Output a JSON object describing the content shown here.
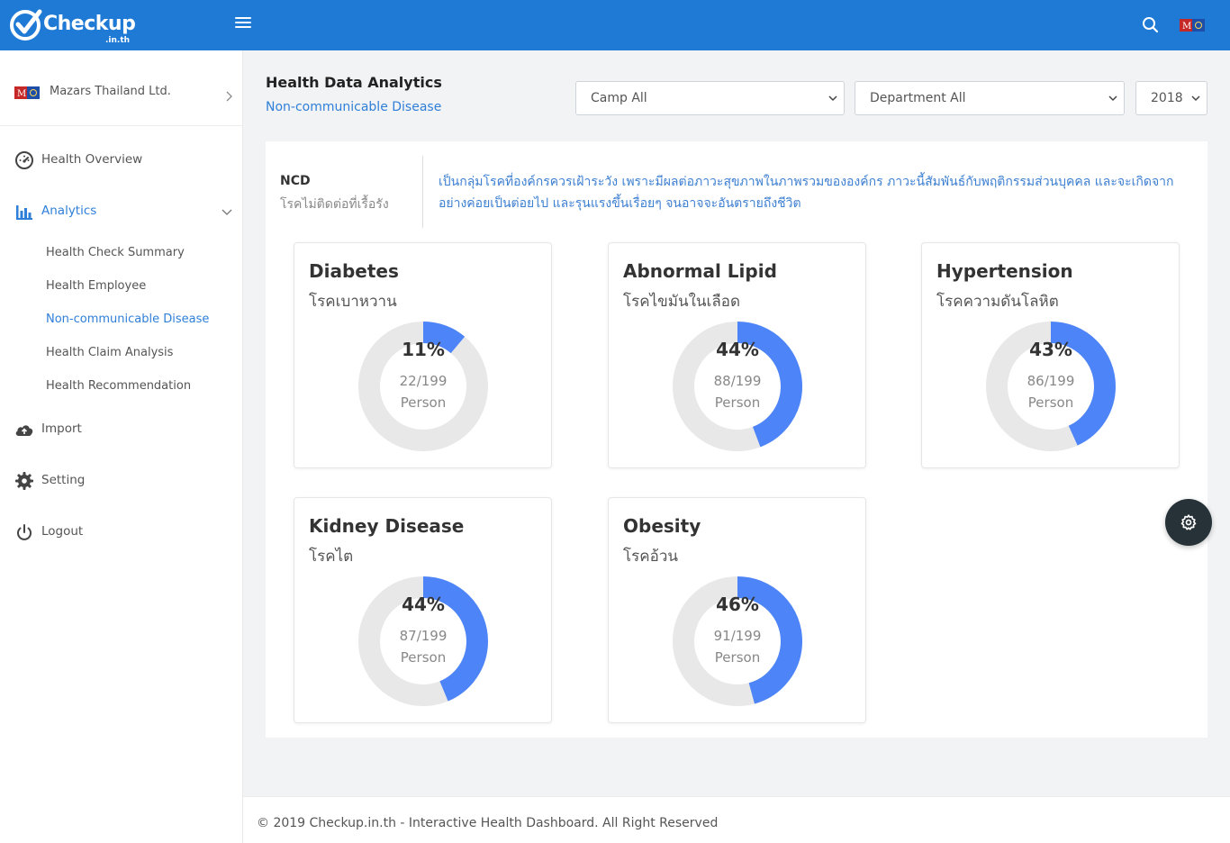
{
  "brand": {
    "name": "Checkup",
    "suffix": ".in.th"
  },
  "topbar": {
    "search_icon": "search-icon",
    "menu_icon": "hamburger-icon",
    "flag_icon": "flag-icon"
  },
  "sidebar": {
    "company": {
      "name": "Mazars Thailand Ltd.",
      "flag": "flag-icon"
    },
    "items": [
      {
        "label": "Health Overview",
        "icon": "dashboard-gauge-icon"
      },
      {
        "label": "Analytics",
        "icon": "bar-chart-icon",
        "active": true
      },
      {
        "label": "Import",
        "icon": "cloud-upload-icon"
      },
      {
        "label": "Setting",
        "icon": "gear-icon"
      },
      {
        "label": "Logout",
        "icon": "power-icon"
      }
    ],
    "sub_items": [
      {
        "label": "Health Check Summary"
      },
      {
        "label": "Health Employee"
      },
      {
        "label": "Non-communicable Disease",
        "active": true
      },
      {
        "label": "Health Claim Analysis"
      },
      {
        "label": "Health Recommendation"
      }
    ]
  },
  "header": {
    "title": "Health Data Analytics",
    "subtitle": "Non-communicable Disease",
    "filters": {
      "camp": "Camp All",
      "department": "Department All",
      "year": "2018"
    }
  },
  "ncd": {
    "title": "NCD",
    "subtitle": "โรคไม่ติดต่อที่เรื้อรัง",
    "description": "เป็นกลุ่มโรคที่องค์กรควรเฝ้าระวัง เพราะมีผลต่อภาวะสุขภาพในภาพรวมขององค์กร ภาวะนี้สัมพันธ์กับพฤติกรรมส่วนบุคคล และจะเกิดจากอย่างค่อยเป็นต่อยไป และรุนแรงขึ้นเรื่อยๆ จนอาจจะอันตรายถึงชีวิต"
  },
  "cards": [
    {
      "title": "Diabetes",
      "subtitle": "โรคเบาหวาน",
      "percent_label": "11%",
      "count": "22/199",
      "unit": "Person",
      "value": 22,
      "total": 199
    },
    {
      "title": "Abnormal Lipid",
      "subtitle": "โรคไขมันในเลือด",
      "percent_label": "44%",
      "count": "88/199",
      "unit": "Person",
      "value": 88,
      "total": 199
    },
    {
      "title": "Hypertension",
      "subtitle": "โรคความดันโลหิต",
      "percent_label": "43%",
      "count": "86/199",
      "unit": "Person",
      "value": 86,
      "total": 199
    },
    {
      "title": "Kidney Disease",
      "subtitle": "โรคไต",
      "percent_label": "44%",
      "count": "87/199",
      "unit": "Person",
      "value": 87,
      "total": 199
    },
    {
      "title": "Obesity",
      "subtitle": "โรคอ้วน",
      "percent_label": "46%",
      "count": "91/199",
      "unit": "Person",
      "value": 91,
      "total": 199
    }
  ],
  "colors": {
    "accent": "#1f7ad6",
    "donut_fill": "#4d84f8",
    "donut_track": "#e8e8e8",
    "link": "#2f7fd8"
  },
  "footer": {
    "text": "© 2019 Checkup.in.th - Interactive Health Dashboard. All Right Reserved"
  }
}
